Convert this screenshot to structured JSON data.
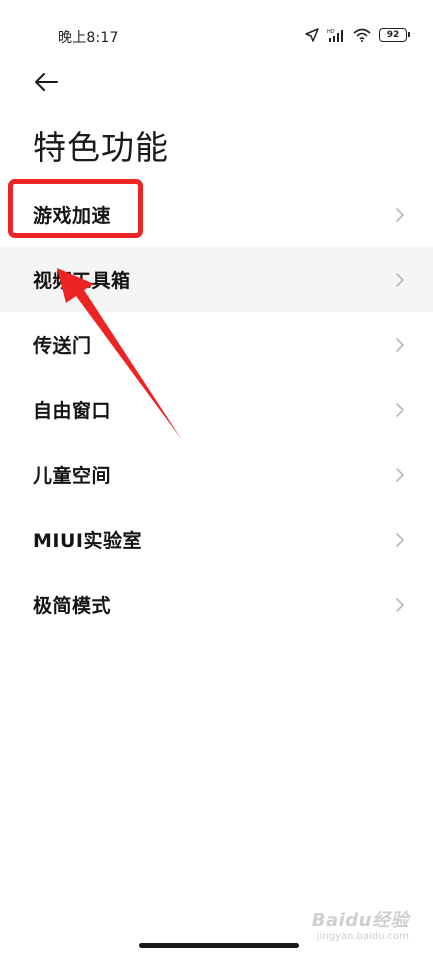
{
  "status_bar": {
    "time": "晚上8:17",
    "battery": "92",
    "icons": [
      "location-icon",
      "signal-icon",
      "wifi-icon",
      "battery-icon"
    ]
  },
  "header": {
    "title": "特色功能",
    "back_icon": "arrow-left-icon"
  },
  "menu": {
    "items": [
      {
        "label": "游戏加速"
      },
      {
        "label": "视频工具箱"
      },
      {
        "label": "传送门"
      },
      {
        "label": "自由窗口"
      },
      {
        "label": "儿童空间"
      },
      {
        "label": "MIUI实验室"
      },
      {
        "label": "极简模式"
      }
    ],
    "chevron_icon": "chevron-right-icon"
  },
  "annotation": {
    "color": "#ee2323"
  },
  "watermark": {
    "brand": "Baidu经验",
    "url": "jingyan.baidu.com"
  }
}
